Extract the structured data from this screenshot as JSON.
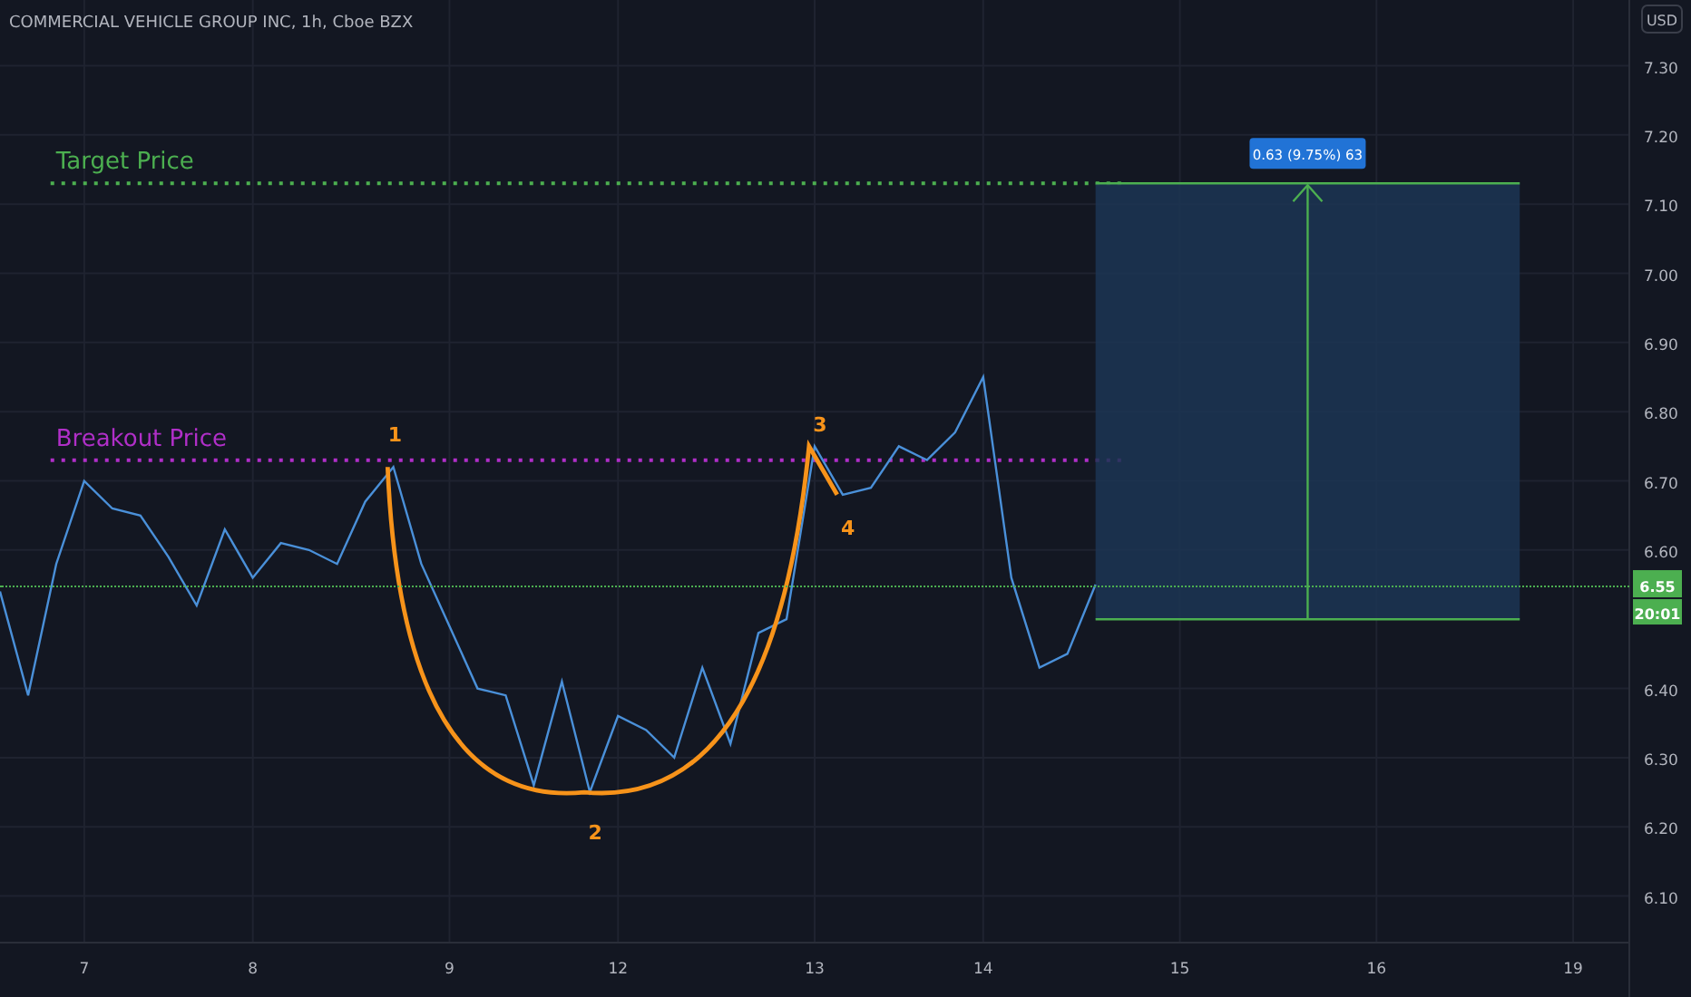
{
  "header": {
    "title": "COMMERCIAL VEHICLE GROUP INC, 1h, Cboe BZX"
  },
  "currency_button": {
    "label": "USD"
  },
  "price_scale": {
    "last_price": "6.55",
    "countdown": "20:01",
    "color": "#4caf50"
  },
  "chart": {
    "chart_data": {
      "type": "line",
      "categories": [
        null,
        null,
        null,
        "7",
        null,
        null,
        null,
        null,
        null,
        "8",
        null,
        null,
        null,
        null,
        null,
        null,
        "9",
        null,
        null,
        null,
        null,
        null,
        "12",
        null,
        null,
        null,
        null,
        null,
        null,
        "13",
        null,
        null,
        null,
        null,
        null,
        "14",
        null,
        null,
        null,
        null,
        null,
        null,
        "15",
        null,
        null,
        null,
        null,
        null,
        null,
        "16",
        null,
        null,
        null,
        null,
        null,
        null,
        "19",
        null
      ],
      "series": [
        {
          "color": "#4a90d9",
          "values": [
            6.54,
            6.39,
            6.58,
            6.7,
            6.66,
            6.65,
            6.59,
            6.52,
            6.63,
            6.56,
            6.61,
            6.6,
            6.58,
            6.67,
            6.72,
            6.58,
            6.49,
            6.4,
            6.39,
            6.26,
            6.41,
            6.25,
            6.36,
            6.34,
            6.3,
            6.43,
            6.32,
            6.48,
            6.5,
            6.75,
            6.68,
            6.69,
            6.75,
            6.73,
            6.77,
            6.85,
            6.56,
            6.43,
            6.45,
            6.55,
            null,
            null,
            null,
            null,
            null,
            null,
            null,
            null,
            null,
            null,
            null,
            null,
            null,
            null,
            null,
            null,
            null,
            null
          ]
        }
      ],
      "ylim": [
        5.954,
        7.395
      ],
      "grid": true,
      "yticks": [
        {
          "value": 6.1,
          "label": "6.10"
        },
        {
          "value": 6.2,
          "label": "6.20"
        },
        {
          "value": 6.3,
          "label": "6.30"
        },
        {
          "value": 6.4,
          "label": "6.40"
        },
        {
          "value": 6.6,
          "label": "6.60"
        },
        {
          "value": 6.7,
          "label": "6.70"
        },
        {
          "value": 6.8,
          "label": "6.80"
        },
        {
          "value": 6.9,
          "label": "6.90"
        },
        {
          "value": 7.0,
          "label": "7.00"
        },
        {
          "value": 7.1,
          "label": "7.10"
        },
        {
          "value": 7.2,
          "label": "7.20"
        },
        {
          "value": 7.3,
          "label": "7.30"
        }
      ],
      "annotations": [
        "Target Price",
        "Breakout Price",
        "1",
        "2",
        "3",
        "4",
        "0.63 (9.75%) 63"
      ]
    }
  }
}
